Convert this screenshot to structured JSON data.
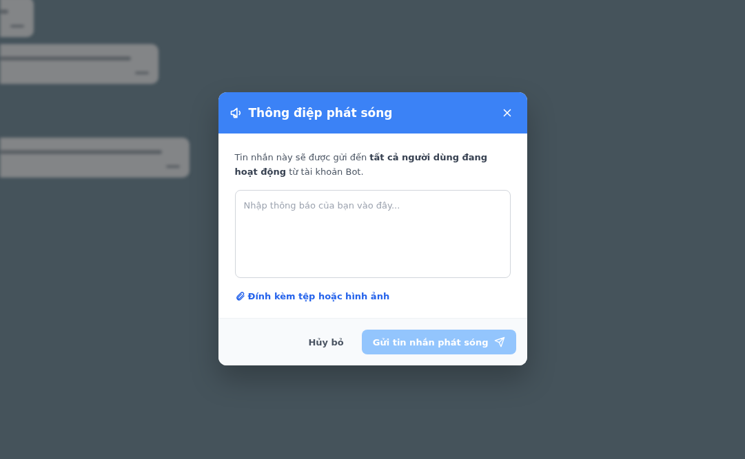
{
  "dialog": {
    "title": "Thông điệp phát sóng",
    "description": "Tin nhắn này sẽ được gửi đến **tất cả người dùng đang hoạt động** từ tài khoản Bot.",
    "message_field": {
      "placeholder": "Nhập thông báo của bạn vào đây..."
    },
    "attach_link": "Đính kèm tệp hoặc hình ảnh",
    "cancel_button": "Hủy bỏ",
    "send_button": {
      "label": "Gửi tin nhắn phát sóng",
      "disabled": true
    }
  }
}
